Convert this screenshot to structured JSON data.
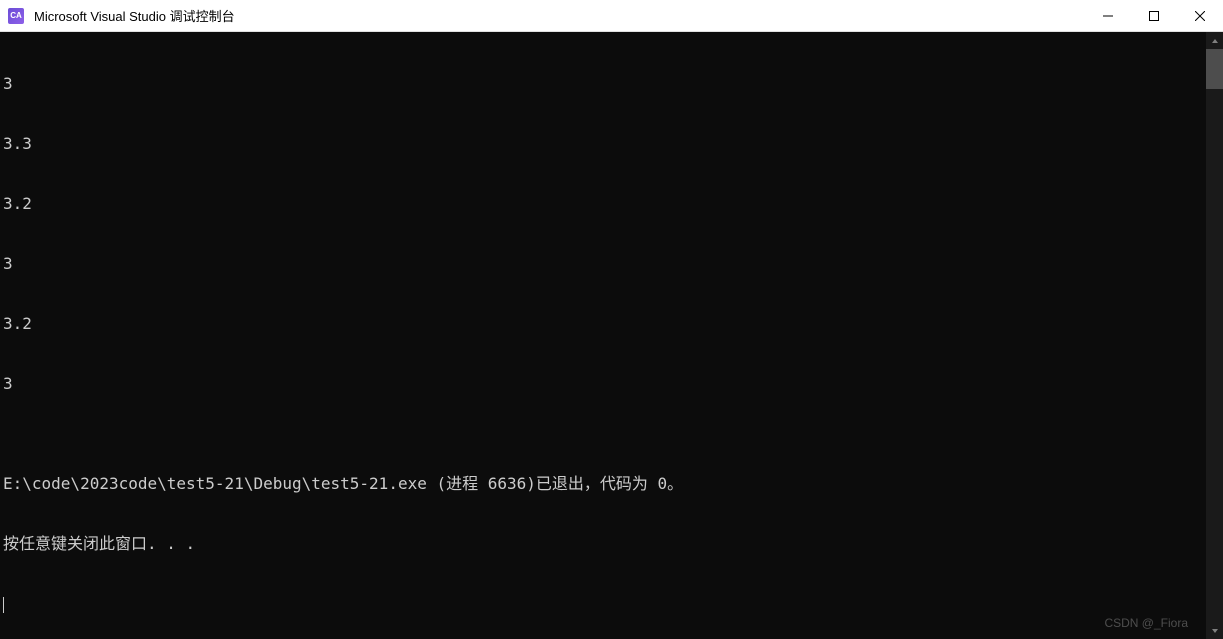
{
  "titlebar": {
    "icon_label": "CA",
    "title": "Microsoft Visual Studio 调试控制台"
  },
  "console": {
    "lines": [
      "3",
      "3.3",
      "3.2",
      "3",
      "3.2",
      "3",
      "",
      "E:\\code\\2023code\\test5-21\\Debug\\test5-21.exe (进程 6636)已退出，代码为 0。",
      "按任意键关闭此窗口. . ."
    ]
  },
  "watermark": "CSDN @_Fiora"
}
